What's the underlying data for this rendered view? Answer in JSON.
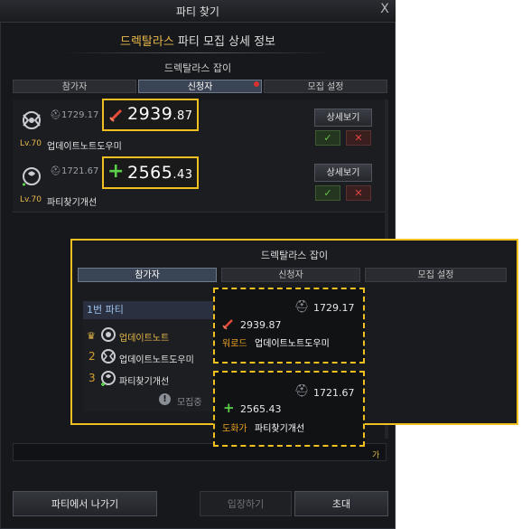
{
  "window": {
    "title": "파티 찾기",
    "close": "X"
  },
  "header": {
    "raid": "드렉탈라스",
    "rest": " 파티 모집 상세 정보"
  },
  "raid_name": "드렉탈라스 잡이",
  "tabs": [
    {
      "label": "참가자"
    },
    {
      "label": "신청자"
    },
    {
      "label": "모집 설정"
    }
  ],
  "applicants": [
    {
      "level": "Lv.70",
      "name": "업데이트노트도우미",
      "item_level": "1729.17",
      "power_int": "2939",
      "power_dec": ".87",
      "power_icon": "sword-icon",
      "details_label": "상세보기",
      "accept": "✓",
      "reject": "✕"
    },
    {
      "level": "Lv.70",
      "name": "파티찾기개선",
      "item_level": "1721.67",
      "power_int": "2565",
      "power_dec": ".43",
      "power_icon": "plus-icon",
      "details_label": "상세보기",
      "accept": "✓",
      "reject": "✕"
    }
  ],
  "chat_char": "가",
  "buttons": {
    "leave": "파티에서 나가기",
    "enter": "입장하기",
    "invite": "초대"
  },
  "inset": {
    "title": "드렉탈라스 잡이",
    "tabs": [
      {
        "label": "참가자"
      },
      {
        "label": "신청자"
      },
      {
        "label": "모집 설정"
      }
    ],
    "party": "1번 파티",
    "members": [
      {
        "num": "",
        "name": "업데이트노트",
        "leader": true
      },
      {
        "num": "2",
        "name": "업데이트노트도우미"
      },
      {
        "num": "3",
        "name": "파티찾기개선"
      }
    ],
    "recruiting": "모집중",
    "callouts": [
      {
        "item_level": "1729.17",
        "power": "2939.87",
        "class": "워로드",
        "name": "업데이트노트도우미"
      },
      {
        "item_level": "1721.67",
        "power": "2565.43",
        "class": "도화가",
        "name": "파티찾기개선"
      }
    ]
  },
  "colors": {
    "accent": "#e8b84a",
    "highlight": "#f0c020",
    "accept": "#67c24a",
    "reject": "#dd4444"
  }
}
